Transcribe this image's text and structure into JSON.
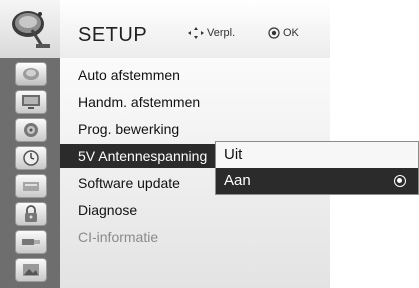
{
  "header": {
    "title": "SETUP",
    "move_hint": "Verpl.",
    "ok_hint": "OK"
  },
  "sidebar": {
    "icons": [
      "satellite-dish-icon",
      "monitor-icon",
      "speaker-icon",
      "clock-icon",
      "lock-icon",
      "input-icon",
      "usb-icon",
      "photo-icon"
    ]
  },
  "menu": {
    "items": [
      {
        "label": "Auto afstemmen"
      },
      {
        "label": "Handm. afstemmen"
      },
      {
        "label": "Prog. bewerking"
      },
      {
        "label": "5V Antennespanning"
      },
      {
        "label": "Software update"
      },
      {
        "label": "Diagnose"
      },
      {
        "label": "CI-informatie"
      }
    ]
  },
  "popup": {
    "options": [
      {
        "label": "Uit"
      },
      {
        "label": "Aan"
      }
    ]
  },
  "colors": {
    "highlight": "#2b2b2b",
    "sidebar": "#6e6e6e"
  }
}
